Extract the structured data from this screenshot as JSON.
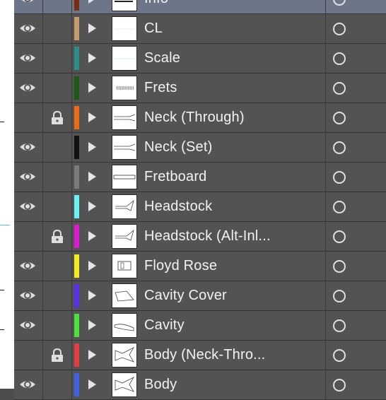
{
  "layers_panel": {
    "layers": [
      {
        "name": "Info",
        "color": "#7a2e10",
        "visible": true,
        "locked": false,
        "selected": true,
        "thumb": "info"
      },
      {
        "name": "CL",
        "color": "#c79a6a",
        "visible": true,
        "locked": false,
        "selected": false,
        "thumb": "blank"
      },
      {
        "name": "Scale",
        "color": "#2b8f88",
        "visible": true,
        "locked": false,
        "selected": false,
        "thumb": "scale"
      },
      {
        "name": "Frets",
        "color": "#1e5a16",
        "visible": true,
        "locked": false,
        "selected": false,
        "thumb": "frets"
      },
      {
        "name": "Neck (Through)",
        "color": "#ee6a12",
        "visible": false,
        "locked": true,
        "selected": false,
        "thumb": "neck"
      },
      {
        "name": "Neck (Set)",
        "color": "#111111",
        "visible": true,
        "locked": false,
        "selected": false,
        "thumb": "neck"
      },
      {
        "name": "Fretboard",
        "color": "#7a7a7a",
        "visible": true,
        "locked": false,
        "selected": false,
        "thumb": "fretboard"
      },
      {
        "name": "Headstock",
        "color": "#67f1f4",
        "visible": true,
        "locked": false,
        "selected": false,
        "thumb": "headstock"
      },
      {
        "name": "Headstock (Alt-Inl...",
        "color": "#e018d2",
        "visible": false,
        "locked": true,
        "selected": false,
        "thumb": "headstock"
      },
      {
        "name": "Floyd Rose",
        "color": "#f4ec1e",
        "visible": true,
        "locked": false,
        "selected": false,
        "thumb": "floyd"
      },
      {
        "name": "Cavity Cover",
        "color": "#5b2ff0",
        "visible": true,
        "locked": false,
        "selected": false,
        "thumb": "cavitycover"
      },
      {
        "name": "Cavity",
        "color": "#49e13a",
        "visible": true,
        "locked": false,
        "selected": false,
        "thumb": "cavity"
      },
      {
        "name": "Body (Neck-Thro...",
        "color": "#e63b3f",
        "visible": false,
        "locked": true,
        "selected": false,
        "thumb": "body"
      },
      {
        "name": "Body",
        "color": "#3f60e6",
        "visible": true,
        "locked": false,
        "selected": false,
        "thumb": "body"
      }
    ]
  },
  "icons": {
    "visibility": "eye-icon",
    "lock": "lock-icon",
    "expand": "disclosure-triangle-icon",
    "target": "target-circle-icon"
  }
}
